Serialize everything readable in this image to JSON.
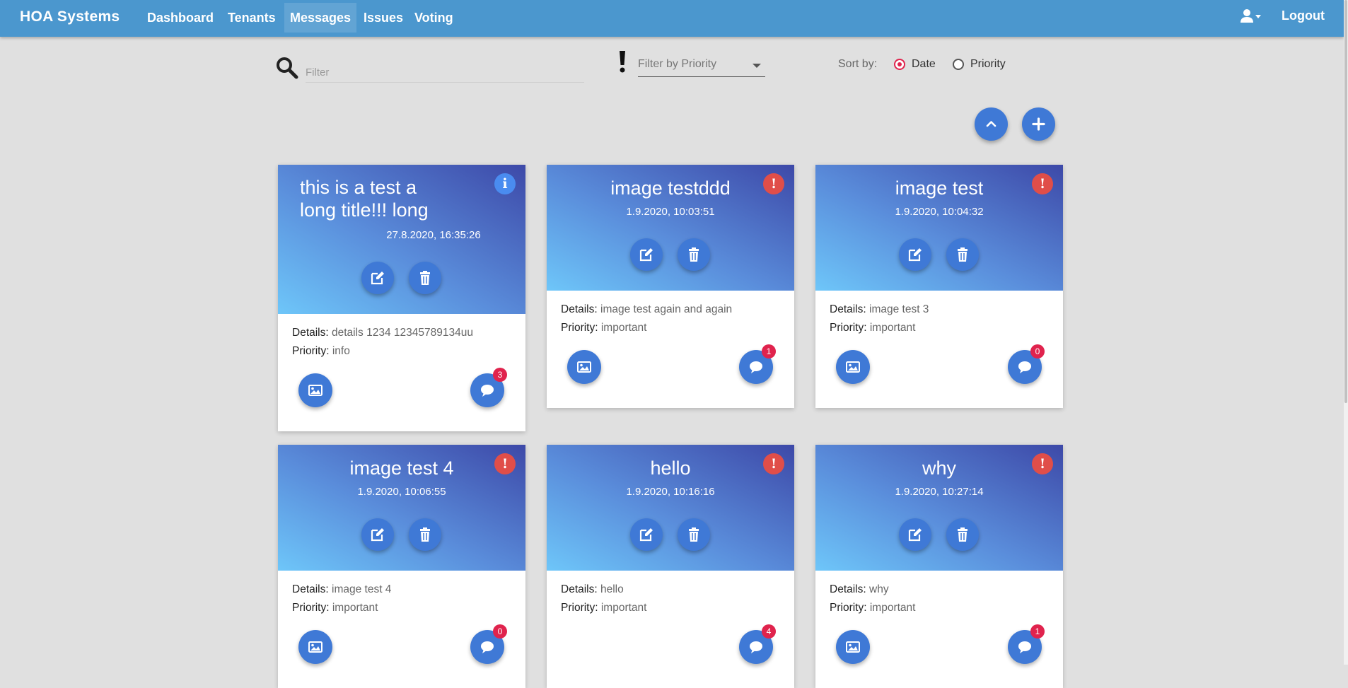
{
  "nav": {
    "brand": "HOA Systems",
    "items": [
      "Dashboard",
      "Tenants",
      "Messages",
      "Issues",
      "Voting"
    ],
    "active": "Messages",
    "logout": "Logout"
  },
  "toolbar": {
    "filter_placeholder": "Filter",
    "priority_filter_label": "Filter by Priority",
    "sort_label": "Sort by:",
    "sort_options": [
      "Date",
      "Priority"
    ],
    "sort_selected": "Date"
  },
  "labels": {
    "details": "Details:",
    "priority": "Priority:"
  },
  "colors": {
    "navbar": "#4b97ce",
    "accent_button": "#3f79d6",
    "important": "#e04e49",
    "info": "#4a8cf0",
    "badge": "#e0234d",
    "selected_radio": "#e0234d"
  },
  "messages": [
    {
      "title": "this is a test a long title!!! long",
      "date": "27.8.2020, 16:35:26",
      "details": "details 1234 12345789134uu",
      "priority": "info",
      "priority_icon": "info-icon",
      "comments": "3",
      "has_image": true
    },
    {
      "title": "image testddd",
      "date": "1.9.2020, 10:03:51",
      "details": "image test again and again",
      "priority": "important",
      "priority_icon": "exclamation-icon",
      "comments": "1",
      "has_image": true
    },
    {
      "title": "image test",
      "date": "1.9.2020, 10:04:32",
      "details": "image test 3",
      "priority": "important",
      "priority_icon": "exclamation-icon",
      "comments": "0",
      "has_image": true
    },
    {
      "title": "image test 4",
      "date": "1.9.2020, 10:06:55",
      "details": "image test 4",
      "priority": "important",
      "priority_icon": "exclamation-icon",
      "comments": "0",
      "has_image": true
    },
    {
      "title": "hello",
      "date": "1.9.2020, 10:16:16",
      "details": "hello",
      "priority": "important",
      "priority_icon": "exclamation-icon",
      "comments": "4",
      "has_image": false
    },
    {
      "title": "why",
      "date": "1.9.2020, 10:27:14",
      "details": "why",
      "priority": "important",
      "priority_icon": "exclamation-icon",
      "comments": "1",
      "has_image": true
    }
  ]
}
